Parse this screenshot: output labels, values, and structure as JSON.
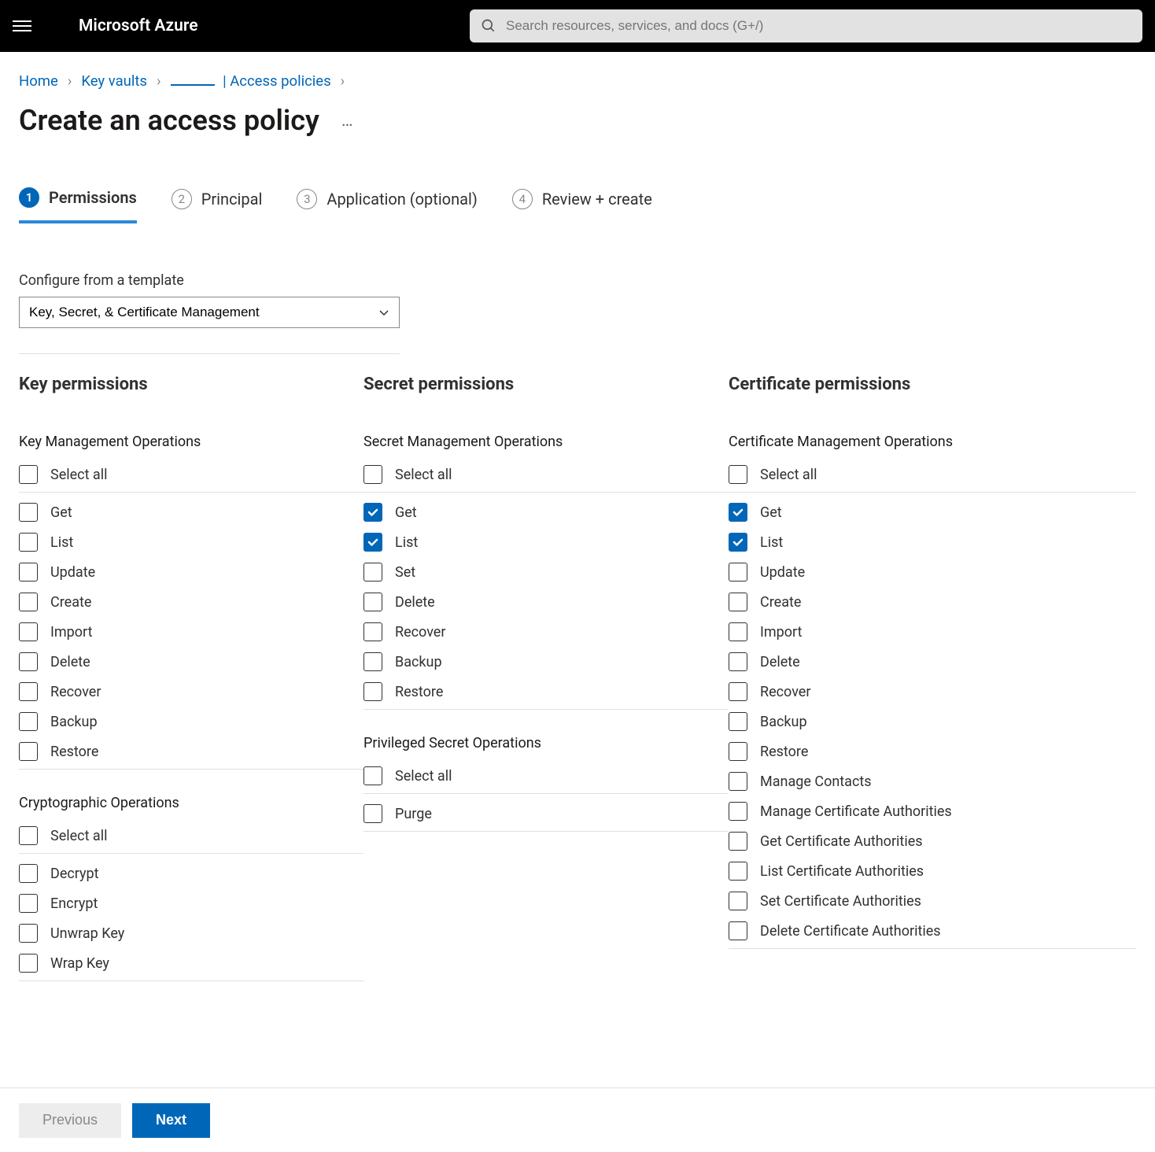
{
  "brand": "Microsoft Azure",
  "search": {
    "placeholder": "Search resources, services, and docs (G+/)"
  },
  "breadcrumbs": {
    "items": [
      "Home",
      "Key vaults"
    ],
    "current_suffix": "| Access policies"
  },
  "page_title": "Create an access policy",
  "steps": [
    {
      "num": "1",
      "label": "Permissions",
      "active": true
    },
    {
      "num": "2",
      "label": "Principal",
      "active": false
    },
    {
      "num": "3",
      "label": "Application (optional)",
      "active": false
    },
    {
      "num": "4",
      "label": "Review + create",
      "active": false
    }
  ],
  "template_label": "Configure from a template",
  "template_value": "Key, Secret, & Certificate Management",
  "columns": {
    "key": {
      "heading": "Key permissions",
      "groups": [
        {
          "title": "Key Management Operations",
          "select_all": "Select all",
          "items": [
            {
              "label": "Get",
              "checked": false
            },
            {
              "label": "List",
              "checked": false
            },
            {
              "label": "Update",
              "checked": false
            },
            {
              "label": "Create",
              "checked": false
            },
            {
              "label": "Import",
              "checked": false
            },
            {
              "label": "Delete",
              "checked": false
            },
            {
              "label": "Recover",
              "checked": false
            },
            {
              "label": "Backup",
              "checked": false
            },
            {
              "label": "Restore",
              "checked": false
            }
          ]
        },
        {
          "title": "Cryptographic Operations",
          "select_all": "Select all",
          "items": [
            {
              "label": "Decrypt",
              "checked": false
            },
            {
              "label": "Encrypt",
              "checked": false
            },
            {
              "label": "Unwrap Key",
              "checked": false
            },
            {
              "label": "Wrap Key",
              "checked": false
            }
          ]
        }
      ]
    },
    "secret": {
      "heading": "Secret permissions",
      "groups": [
        {
          "title": "Secret Management Operations",
          "select_all": "Select all",
          "items": [
            {
              "label": "Get",
              "checked": true
            },
            {
              "label": "List",
              "checked": true
            },
            {
              "label": "Set",
              "checked": false
            },
            {
              "label": "Delete",
              "checked": false
            },
            {
              "label": "Recover",
              "checked": false
            },
            {
              "label": "Backup",
              "checked": false
            },
            {
              "label": "Restore",
              "checked": false
            }
          ]
        },
        {
          "title": "Privileged Secret Operations",
          "select_all": "Select all",
          "items": [
            {
              "label": "Purge",
              "checked": false
            }
          ]
        }
      ]
    },
    "cert": {
      "heading": "Certificate permissions",
      "groups": [
        {
          "title": "Certificate Management Operations",
          "select_all": "Select all",
          "items": [
            {
              "label": "Get",
              "checked": true
            },
            {
              "label": "List",
              "checked": true
            },
            {
              "label": "Update",
              "checked": false
            },
            {
              "label": "Create",
              "checked": false
            },
            {
              "label": "Import",
              "checked": false
            },
            {
              "label": "Delete",
              "checked": false
            },
            {
              "label": "Recover",
              "checked": false
            },
            {
              "label": "Backup",
              "checked": false
            },
            {
              "label": "Restore",
              "checked": false
            },
            {
              "label": "Manage Contacts",
              "checked": false
            },
            {
              "label": "Manage Certificate Authorities",
              "checked": false
            },
            {
              "label": "Get Certificate Authorities",
              "checked": false
            },
            {
              "label": "List Certificate Authorities",
              "checked": false
            },
            {
              "label": "Set Certificate Authorities",
              "checked": false
            },
            {
              "label": "Delete Certificate Authorities",
              "checked": false
            }
          ]
        }
      ]
    }
  },
  "footer": {
    "prev": "Previous",
    "next": "Next"
  }
}
